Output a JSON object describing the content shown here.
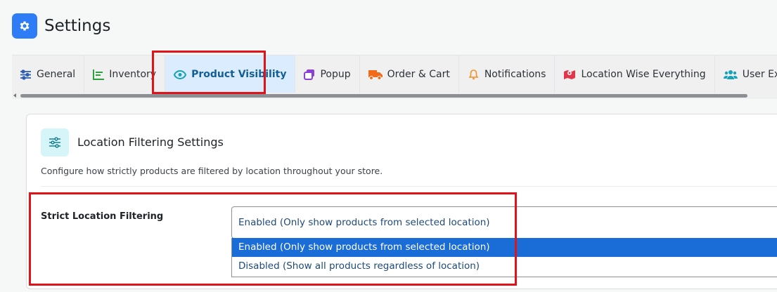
{
  "header": {
    "title": "Settings",
    "icon": "gear-icon"
  },
  "tabs": [
    {
      "label": "General",
      "icon": "sliders-icon",
      "color": "#2f5fb3"
    },
    {
      "label": "Inventory",
      "icon": "chart-icon",
      "color": "#2e9e3e"
    },
    {
      "label": "Product Visibility",
      "icon": "eye-icon",
      "color": "#17a2b8",
      "active": true
    },
    {
      "label": "Popup",
      "icon": "windows-icon",
      "color": "#8b3fd9"
    },
    {
      "label": "Order & Cart",
      "icon": "truck-icon",
      "color": "#f26b1d"
    },
    {
      "label": "Notifications",
      "icon": "bell-icon",
      "color": "#f0932b"
    },
    {
      "label": "Location Wise Everything",
      "icon": "map-icon",
      "color": "#e2364a"
    },
    {
      "label": "User Experience",
      "icon": "users-icon",
      "color": "#17a2b8"
    }
  ],
  "card": {
    "icon": "sliders-icon",
    "title": "Location Filtering Settings",
    "description": "Configure how strictly products are filtered by location throughout your store."
  },
  "field": {
    "label": "Strict Location Filtering",
    "selected_value": "Enabled (Only show products from selected location)",
    "options": [
      "Enabled (Only show products from selected location)",
      "Disabled (Show all products regardless of location)"
    ],
    "selected_index": 0
  },
  "colors": {
    "accent": "#2e7cf6",
    "highlight": "#e0131a",
    "option_selected": "#1a6cd6"
  }
}
